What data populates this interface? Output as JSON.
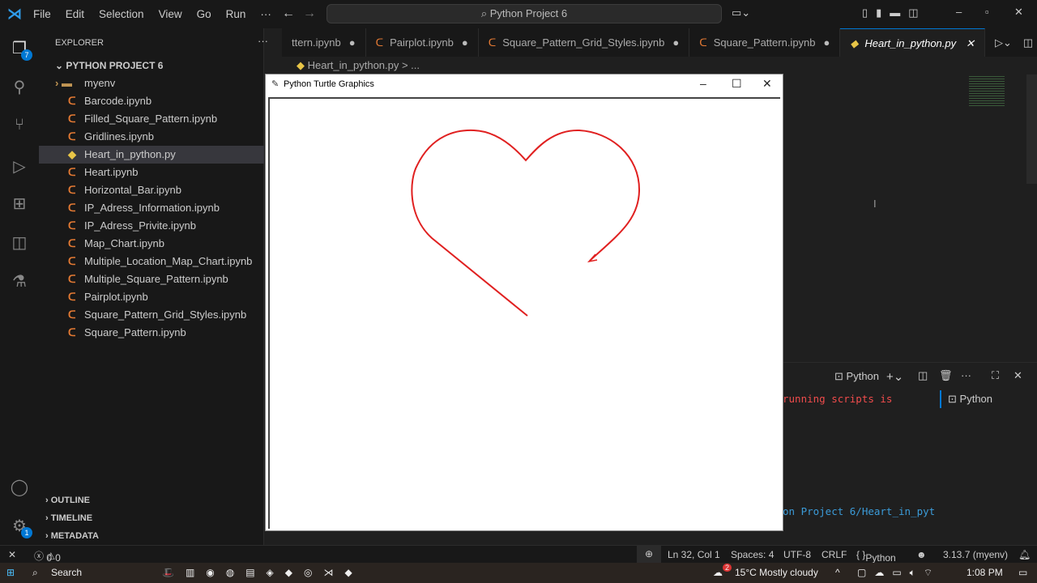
{
  "menu": [
    "File",
    "Edit",
    "Selection",
    "View",
    "Go",
    "Run",
    "···"
  ],
  "search": "Python Project 6",
  "activity": {
    "explorer_badge": "7",
    "settings_badge": "1"
  },
  "sidebar": {
    "title": "EXPLORER",
    "project": "PYTHON PROJECT 6",
    "items": [
      {
        "label": "myenv",
        "type": "folder"
      },
      {
        "label": "Barcode.ipynb"
      },
      {
        "label": "Filled_Square_Pattern.ipynb"
      },
      {
        "label": "Gridlines.ipynb"
      },
      {
        "label": "Heart_in_python.py",
        "selected": true
      },
      {
        "label": "Heart.ipynb"
      },
      {
        "label": "Horizontal_Bar.ipynb"
      },
      {
        "label": "IP_Adress_Information.ipynb"
      },
      {
        "label": "IP_Adress_Privite.ipynb"
      },
      {
        "label": "Map_Chart.ipynb"
      },
      {
        "label": "Multiple_Location_Map_Chart.ipynb"
      },
      {
        "label": "Multiple_Square_Pattern.ipynb"
      },
      {
        "label": "Pairplot.ipynb"
      },
      {
        "label": "Square_Pattern_Grid_Styles.ipynb"
      },
      {
        "label": "Square_Pattern.ipynb"
      }
    ],
    "sections": [
      "OUTLINE",
      "TIMELINE",
      "METADATA"
    ]
  },
  "tabs": [
    "ttern.ipynb",
    "Pairplot.ipynb",
    "Square_Pattern_Grid_Styles.ipynb",
    "Square_Pattern.ipynb",
    "Heart_in_python.py"
  ],
  "breadcrumb": "Heart_in_python.py > ...",
  "turtle": {
    "title": "Python Turtle Graphics",
    "pen_color": "#e02020"
  },
  "terminal": {
    "tab": "Python",
    "list_item": "Python",
    "line1": "running scripts is",
    "line2": "on Project 6/Heart_in_pyt"
  },
  "status": {
    "errors": "0",
    "warnings": "0",
    "position": "Ln 32, Col 1",
    "spaces": "Spaces: 4",
    "encoding": "UTF-8",
    "eol": "CRLF",
    "language": "Python",
    "interpreter": "3.13.7 (myenv)"
  },
  "taskbar": {
    "search": "Search",
    "weather": "15°C  Mostly cloudy",
    "time": "1:08 PM",
    "weather_badge": "2"
  }
}
